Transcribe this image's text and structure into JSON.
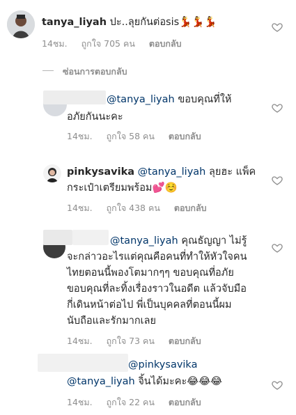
{
  "comments": [
    {
      "username": "tanya_liyah",
      "text": "ปะ..ลุยกันต่อsis💃💃💃",
      "meta": {
        "time": "14ชม.",
        "likes": "ถูกใจ 705 คน",
        "reply": "ตอบกลับ"
      }
    },
    {
      "hide_replies": "ซ่อนการตอบกลับ"
    },
    {
      "mention": "@tanya_liyah",
      "text_1": "ขอบคุณที่ให้",
      "text_2": "อภัยกันนะคะ",
      "meta": {
        "time": "14ชม.",
        "likes": "ถูกใจ 58 คน",
        "reply": "ตอบกลับ"
      }
    },
    {
      "username": "pinkysavika",
      "mention": "@tanya_liyah",
      "text_1": "ลุยฮะ แพ็ค",
      "text_2": "กระเป๋าเตรียมพร้อม💕☺️",
      "meta": {
        "time": "14ชม.",
        "likes": "ถูกใจ 438 คน",
        "reply": "ตอบกลับ"
      }
    },
    {
      "mention": "@tanya_liyah",
      "line_1": "คุณธัญญา ไม่รู้",
      "line_2": "จะกล่าวอะไรแต่คุณคือคนที่ทำให้หัวใจคน",
      "line_3": "ไทยตอนนี้พองโตมากๆๆ ขอบคุณที่อภัย",
      "line_4": "ขอบคุณที่ละทิ้งเรื่องราวในอดีต แล้วจับมือ",
      "line_5": "กี่เดินหน้าต่อไป พี่เป็นบุคคลที่ตอนนี้ผม",
      "line_6": "นับถือและรักมากเลย",
      "meta": {
        "time": "14ชม.",
        "likes": "ถูกใจ 73 คน",
        "reply": "ตอบกลับ"
      }
    },
    {
      "mention_1": "@pinkysavika",
      "mention_2": "@tanya_liyah",
      "text": "จิ้นได้มะคะ😂😂😂",
      "meta": {
        "time": "14ชม.",
        "likes": "ถูกใจ 22 คน",
        "reply": "ตอบกลับ"
      }
    }
  ]
}
